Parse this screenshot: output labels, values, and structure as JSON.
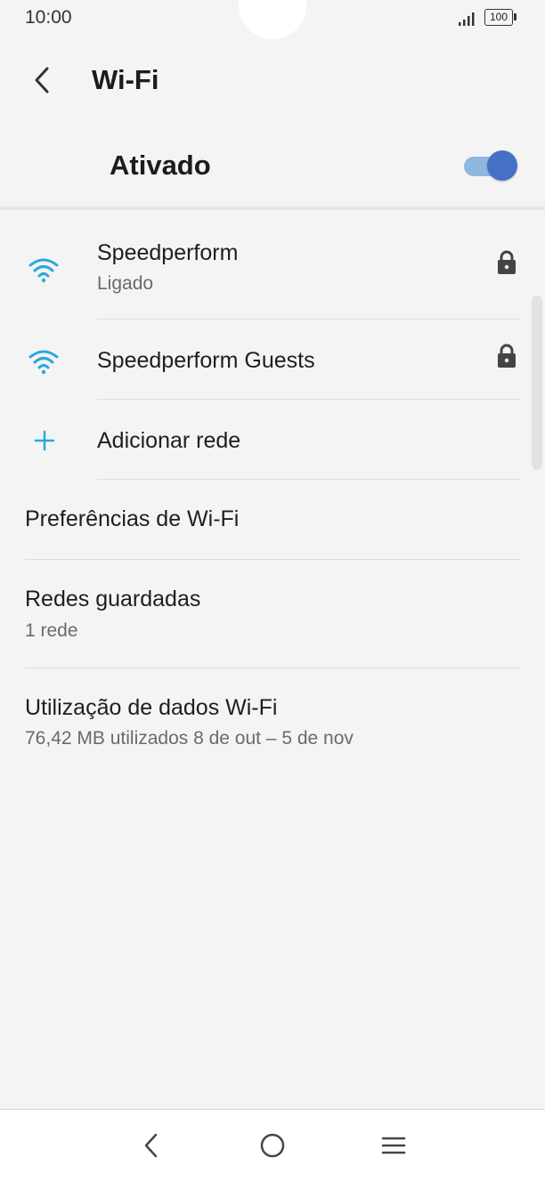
{
  "status_bar": {
    "time": "10:00",
    "battery": "100",
    "signal_icon": "signal-bars-icon"
  },
  "header": {
    "back_icon": "back-arrow-icon",
    "title": "Wi-Fi"
  },
  "master_toggle": {
    "label": "Ativado",
    "state": "on",
    "track_color": "#8fb8e0",
    "thumb_color": "#4471c4"
  },
  "networks": [
    {
      "name": "Speedperform",
      "status": "Ligado",
      "icon": "wifi-icon",
      "secured_icon": "lock-icon"
    },
    {
      "name": "Speedperform Guests",
      "icon": "wifi-icon",
      "secured_icon": "lock-icon"
    }
  ],
  "add_network": {
    "label": "Adicionar rede",
    "icon": "plus-icon"
  },
  "preferences": [
    {
      "title": "Preferências de Wi-Fi"
    },
    {
      "title": "Redes guardadas",
      "subtitle": "1 rede"
    },
    {
      "title": "Utilização de dados Wi-Fi",
      "subtitle": "76,42 MB utilizados 8 de out – 5 de nov"
    }
  ],
  "nav_bar": {
    "back_icon": "nav-back-icon",
    "home_icon": "nav-home-icon",
    "menu_icon": "nav-menu-icon"
  },
  "colors": {
    "accent": "#29a8e0",
    "background": "#f4f4f4"
  }
}
